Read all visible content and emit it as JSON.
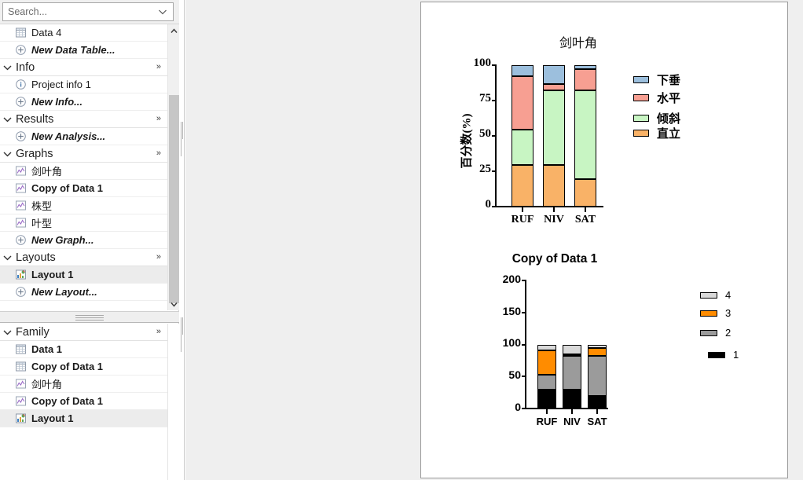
{
  "search": {
    "placeholder": "Search...",
    "value": "",
    "chevron_icon": "chevron-down-icon"
  },
  "navigator": {
    "top_tree": [
      {
        "kind": "item",
        "label": "Data 4",
        "icon": "data-table-icon",
        "style": "normal",
        "selected": false
      },
      {
        "kind": "item",
        "label": "New Data Table...",
        "icon": "plus-circle-icon",
        "style": "italic",
        "selected": false
      },
      {
        "kind": "group",
        "label": "Info"
      },
      {
        "kind": "item",
        "label": "Project info 1",
        "icon": "info-circle-icon",
        "style": "normal",
        "selected": false
      },
      {
        "kind": "item",
        "label": "New Info...",
        "icon": "plus-circle-icon",
        "style": "italic",
        "selected": false
      },
      {
        "kind": "group",
        "label": "Results"
      },
      {
        "kind": "item",
        "label": "New Analysis...",
        "icon": "plus-circle-icon",
        "style": "italic",
        "selected": false
      },
      {
        "kind": "group",
        "label": "Graphs"
      },
      {
        "kind": "item",
        "label": "剑叶角",
        "icon": "graph-icon",
        "style": "normal",
        "selected": false
      },
      {
        "kind": "item",
        "label": "Copy of Data 1",
        "icon": "graph-icon",
        "style": "bold",
        "selected": false
      },
      {
        "kind": "item",
        "label": "株型",
        "icon": "graph-icon",
        "style": "normal",
        "selected": false
      },
      {
        "kind": "item",
        "label": "叶型",
        "icon": "graph-icon",
        "style": "normal",
        "selected": false
      },
      {
        "kind": "item",
        "label": "New Graph...",
        "icon": "plus-circle-icon",
        "style": "italic",
        "selected": false
      },
      {
        "kind": "group",
        "label": "Layouts"
      },
      {
        "kind": "item",
        "label": "Layout 1",
        "icon": "layout-icon",
        "style": "bold",
        "selected": true
      },
      {
        "kind": "item",
        "label": "New Layout...",
        "icon": "plus-circle-icon",
        "style": "italic",
        "selected": false
      }
    ],
    "bottom_tree": [
      {
        "kind": "group",
        "label": "Family"
      },
      {
        "kind": "item",
        "label": "Data 1",
        "icon": "data-table-icon",
        "style": "bold",
        "selected": false
      },
      {
        "kind": "item",
        "label": "Copy of Data 1",
        "icon": "data-table-icon",
        "style": "bold",
        "selected": false
      },
      {
        "kind": "item",
        "label": "剑叶角",
        "icon": "graph-icon",
        "style": "normal",
        "selected": false
      },
      {
        "kind": "item",
        "label": "Copy of Data 1",
        "icon": "graph-icon",
        "style": "bold",
        "selected": false
      },
      {
        "kind": "item",
        "label": "Layout 1",
        "icon": "layout-icon",
        "style": "bold",
        "selected": true
      }
    ],
    "group_expand_icon": "chevron-down-icon",
    "group_more_icon": "double-chevron-right-icon",
    "scroll_up_icon": "caret-up-icon",
    "scroll_down_icon": "caret-down-icon"
  },
  "chart_data": [
    {
      "id": "chart-jianyejiao",
      "type": "bar",
      "stacked": true,
      "percent": true,
      "title": "剑叶角",
      "xlabel": "",
      "ylabel": "百分数(%)",
      "categories": [
        "RUF",
        "NIV",
        "SAT"
      ],
      "ylim": [
        0,
        100
      ],
      "yticks": [
        0,
        25,
        50,
        75,
        100
      ],
      "grid": false,
      "legend_position": "right",
      "series": [
        {
          "name": "直立",
          "color": "#f9b267",
          "values": [
            29.5,
            29.5,
            19.5
          ]
        },
        {
          "name": "倾斜",
          "color": "#c8f5c3",
          "values": [
            25.0,
            52.5,
            62.5
          ]
        },
        {
          "name": "水平",
          "color": "#f79f92",
          "values": [
            38.0,
            4.5,
            15.5
          ]
        },
        {
          "name": "下垂",
          "color": "#9cbfdd",
          "values": [
            7.5,
            13.5,
            2.5
          ]
        }
      ],
      "legend_order": [
        "下垂",
        "水平",
        "倾斜",
        "直立"
      ]
    },
    {
      "id": "chart-copy-of-data-1",
      "type": "bar",
      "stacked": true,
      "percent": false,
      "title": "Copy of Data 1",
      "xlabel": "",
      "ylabel": "",
      "categories": [
        "RUF",
        "NIV",
        "SAT"
      ],
      "ylim": [
        0,
        200
      ],
      "yticks": [
        0,
        50,
        100,
        150,
        200
      ],
      "grid": false,
      "legend_position": "right",
      "series": [
        {
          "name": "1",
          "color": "#000000",
          "values": [
            29.5,
            29.5,
            19.5
          ]
        },
        {
          "name": "2",
          "color": "#9b9b9b",
          "values": [
            23.5,
            52.5,
            62.5
          ]
        },
        {
          "name": "3",
          "color": "#ff8c00",
          "values": [
            38.0,
            3.0,
            12.5
          ]
        },
        {
          "name": "4",
          "color": "#d9d9d9",
          "values": [
            9.0,
            15.0,
            5.5
          ]
        }
      ],
      "legend_order": [
        "4",
        "3",
        "2",
        "1"
      ]
    }
  ]
}
